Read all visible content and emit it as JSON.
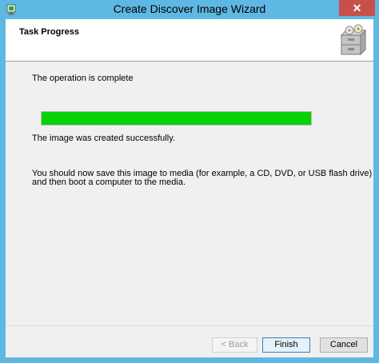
{
  "window": {
    "title": "Create Discover Image Wizard",
    "close_glyph": "✕"
  },
  "header": {
    "title": "Task Progress",
    "graphic_icon": "file-cabinet-icon"
  },
  "content": {
    "status_text": "The operation is complete",
    "progress_percent": 100,
    "result_text": "The image was created successfully.",
    "instruction_line1": "You  should now save this image to media (for example, a CD, DVD,  or USB flash drive)",
    "instruction_line2": "and then boot a computer to the media."
  },
  "buttons": {
    "back_label": "< Back",
    "finish_label": "Finish",
    "cancel_label": "Cancel"
  },
  "colors": {
    "titlebar": "#5fb8e3",
    "progress_fill": "#06d206",
    "close_button": "#c7504b"
  }
}
